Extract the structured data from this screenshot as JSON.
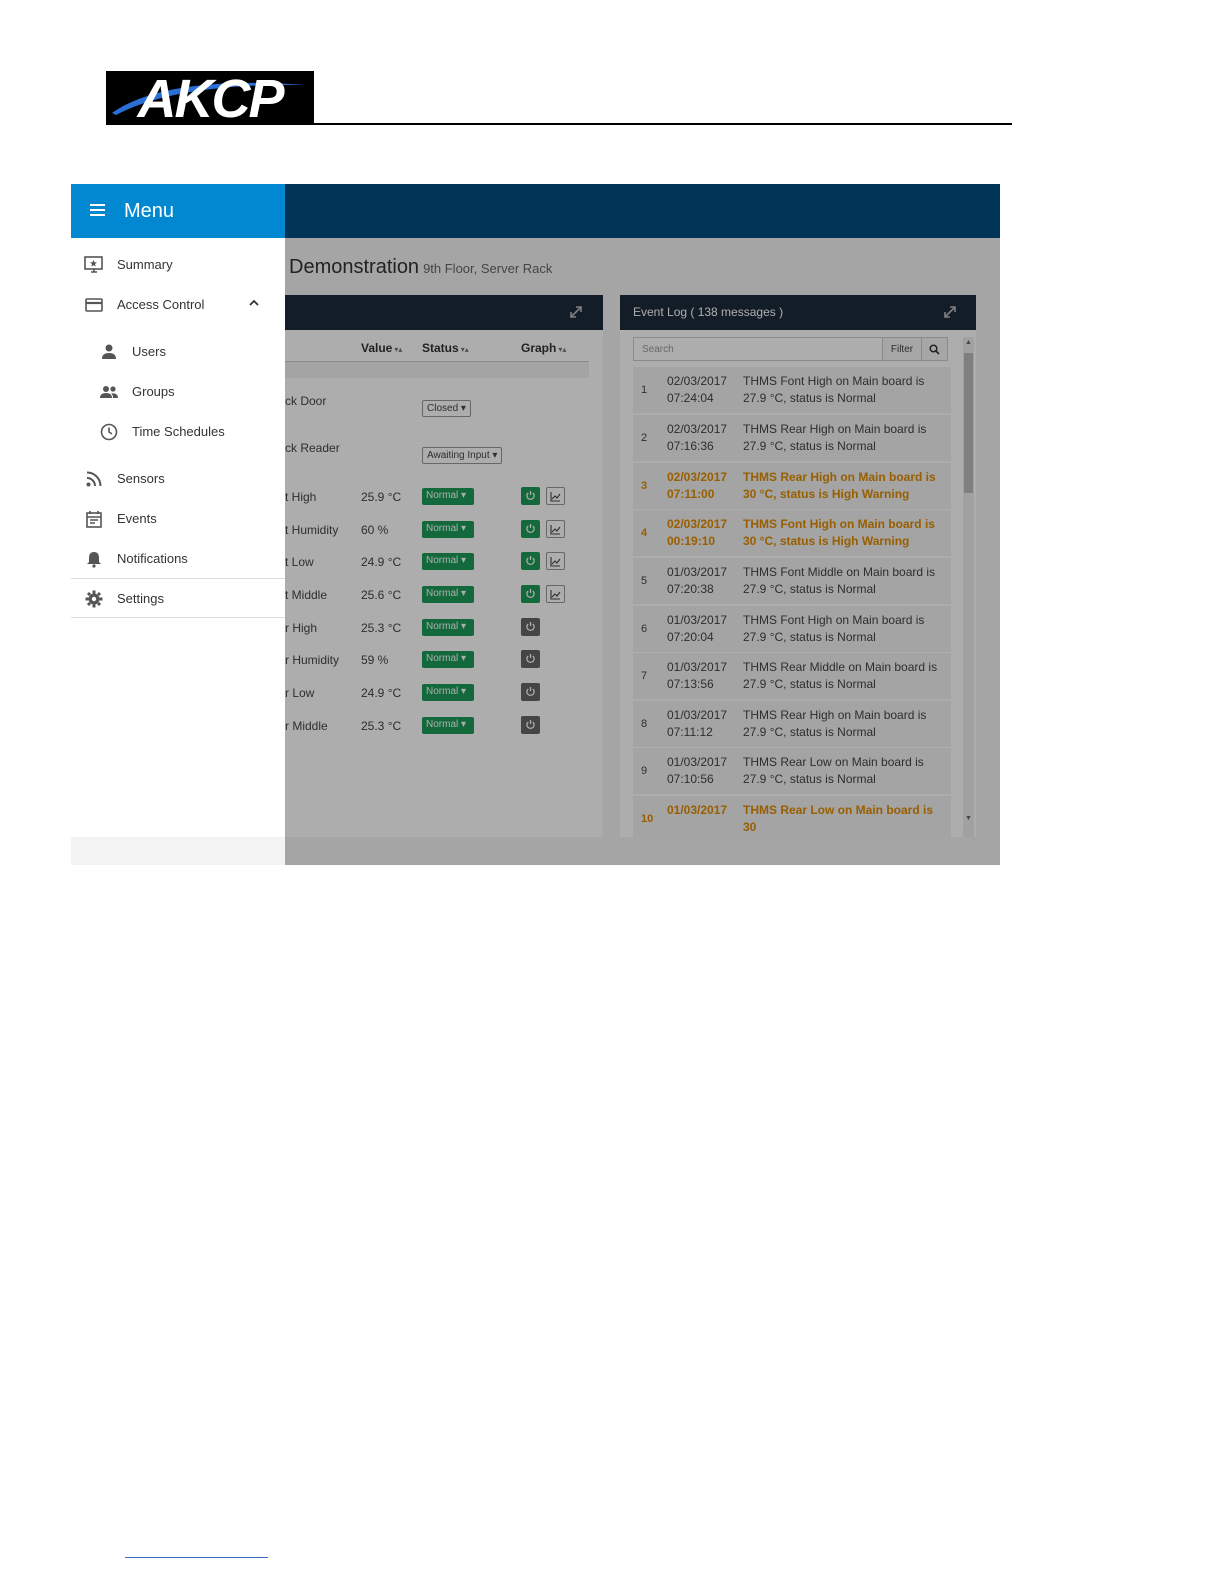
{
  "brand": {
    "logo_text": "AKCP"
  },
  "menu": {
    "title": "Menu",
    "items": [
      {
        "label": "Summary",
        "icon": "monitor-star-icon"
      },
      {
        "label": "Access Control",
        "icon": "card-icon",
        "expanded": true,
        "children": [
          {
            "label": "Users",
            "icon": "person-icon"
          },
          {
            "label": "Groups",
            "icon": "group-icon"
          },
          {
            "label": "Time Schedules",
            "icon": "clock-icon"
          }
        ]
      },
      {
        "label": "Sensors",
        "icon": "rss-icon"
      },
      {
        "label": "Events",
        "icon": "calendar-icon"
      },
      {
        "label": "Notifications",
        "icon": "bell-icon"
      },
      {
        "label": "Settings",
        "icon": "gear-icon"
      }
    ]
  },
  "page": {
    "title": "Demonstration",
    "subtitle": "9th Floor, Server Rack"
  },
  "sensors": {
    "columns": {
      "value": "Value",
      "status": "Status",
      "graph": "Graph"
    },
    "rows": [
      {
        "name": "ck Door",
        "value": "",
        "status": "Closed",
        "status_type": "dropdown"
      },
      {
        "name": "ck Reader",
        "value": "",
        "status": "Awaiting Input",
        "status_type": "dropdown"
      },
      {
        "name": "t High",
        "value": "25.9 °C",
        "status": "Normal",
        "status_type": "badge",
        "power": "on",
        "graph": true
      },
      {
        "name": "t Humidity",
        "value": "60 %",
        "status": "Normal",
        "status_type": "badge",
        "power": "on",
        "graph": true
      },
      {
        "name": "t Low",
        "value": "24.9 °C",
        "status": "Normal",
        "status_type": "badge",
        "power": "on",
        "graph": true
      },
      {
        "name": "t Middle",
        "value": "25.6 °C",
        "status": "Normal",
        "status_type": "badge",
        "power": "on",
        "graph": true
      },
      {
        "name": "r High",
        "value": "25.3 °C",
        "status": "Normal",
        "status_type": "badge",
        "power": "off",
        "graph": false
      },
      {
        "name": "r Humidity",
        "value": "59 %",
        "status": "Normal",
        "status_type": "badge",
        "power": "off",
        "graph": false
      },
      {
        "name": "r Low",
        "value": "24.9 °C",
        "status": "Normal",
        "status_type": "badge",
        "power": "off",
        "graph": false
      },
      {
        "name": "r Middle",
        "value": "25.3 °C",
        "status": "Normal",
        "status_type": "badge",
        "power": "off",
        "graph": false
      }
    ]
  },
  "event_log": {
    "title": "Event Log ( 138 messages )",
    "search_placeholder": "Search",
    "filter_label": "Filter",
    "events": [
      {
        "num": "1",
        "date": "02/03/2017",
        "time": "07:24:04",
        "msg": "THMS Font High on Main board is 27.9 °C, status is Normal",
        "level": "normal"
      },
      {
        "num": "2",
        "date": "02/03/2017",
        "time": "07:16:36",
        "msg": "THMS Rear High on Main board is 27.9 °C, status is Normal",
        "level": "normal"
      },
      {
        "num": "3",
        "date": "02/03/2017",
        "time": "07:11:00",
        "msg": "THMS Rear High on Main board is 30 °C, status is High Warning",
        "level": "warning"
      },
      {
        "num": "4",
        "date": "02/03/2017",
        "time": "00:19:10",
        "msg": "THMS Font High on Main board is 30 °C, status is High Warning",
        "level": "warning"
      },
      {
        "num": "5",
        "date": "01/03/2017",
        "time": "07:20:38",
        "msg": "THMS Font Middle on Main board is 27.9 °C, status is Normal",
        "level": "normal"
      },
      {
        "num": "6",
        "date": "01/03/2017",
        "time": "07:20:04",
        "msg": "THMS Font High on Main board is 27.9 °C, status is Normal",
        "level": "normal"
      },
      {
        "num": "7",
        "date": "01/03/2017",
        "time": "07:13:56",
        "msg": "THMS Rear Middle on Main board is 27.9 °C, status is Normal",
        "level": "normal"
      },
      {
        "num": "8",
        "date": "01/03/2017",
        "time": "07:11:12",
        "msg": "THMS Rear High on Main board is 27.9 °C, status is Normal",
        "level": "normal"
      },
      {
        "num": "9",
        "date": "01/03/2017",
        "time": "07:10:56",
        "msg": "THMS Rear Low on Main board is 27.9 °C, status is Normal",
        "level": "normal"
      },
      {
        "num": "10",
        "date": "01/03/2017",
        "time": "",
        "msg": "THMS Rear Low on Main board is 30",
        "level": "warning"
      }
    ]
  },
  "colors": {
    "topbar": "#004f80",
    "menu_header": "#0288d1",
    "status_normal": "#1d9b57",
    "warning_text": "#e08b00",
    "panel_header": "#1c2b3a"
  }
}
